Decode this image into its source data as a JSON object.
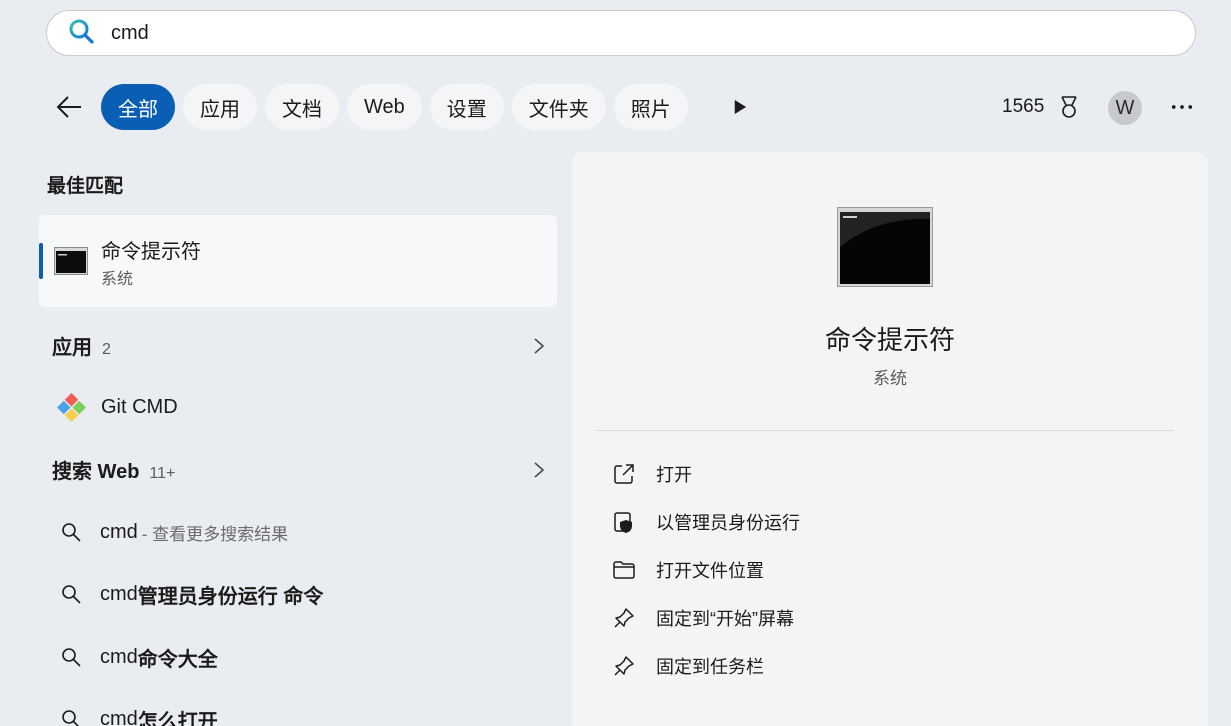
{
  "search": {
    "value": "cmd"
  },
  "filters": {
    "chips": [
      "全部",
      "应用",
      "文档",
      "Web",
      "设置",
      "文件夹",
      "照片"
    ],
    "active_index": 0,
    "points": "1565",
    "avatar_initial": "W"
  },
  "best_match": {
    "title": "最佳匹配",
    "name": "命令提示符",
    "subtitle": "系统"
  },
  "apps": {
    "label": "应用",
    "count": "2",
    "items": [
      {
        "name": "Git CMD"
      }
    ]
  },
  "web": {
    "label": "搜索 Web",
    "count": "11+",
    "results": [
      {
        "prefix": "cmd",
        "hint": "- 查看更多搜索结果",
        "bold": ""
      },
      {
        "prefix": "cmd",
        "hint": "",
        "bold": "管理员身份运行 命令"
      },
      {
        "prefix": "cmd",
        "hint": "",
        "bold": "命令大全"
      },
      {
        "prefix": "cmd",
        "hint": "",
        "bold": "怎么打开"
      }
    ]
  },
  "detail": {
    "name": "命令提示符",
    "subtitle": "系统",
    "actions": [
      {
        "label": "打开",
        "icon": "open-external-icon"
      },
      {
        "label": "以管理员身份运行",
        "icon": "admin-shield-icon"
      },
      {
        "label": "打开文件位置",
        "icon": "folder-icon"
      },
      {
        "label": "固定到“开始”屏幕",
        "icon": "pin-icon"
      },
      {
        "label": "固定到任务栏",
        "icon": "pin-icon"
      }
    ]
  },
  "colors": {
    "accent": "#0a5fb4",
    "background": "#e9ecf0",
    "panel": "#f3f4f6"
  }
}
